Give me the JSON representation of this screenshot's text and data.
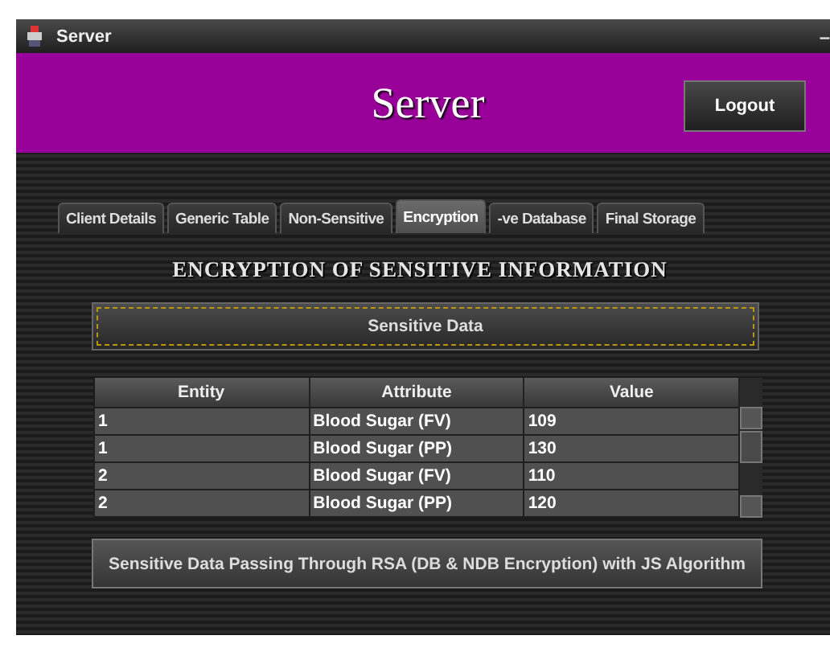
{
  "window": {
    "title": "Server",
    "minimize": "–"
  },
  "header": {
    "title": "Server",
    "logout": "Logout"
  },
  "tabs": [
    {
      "label": "Client Details",
      "selected": false
    },
    {
      "label": "Generic Table",
      "selected": false
    },
    {
      "label": "Non-Sensitive",
      "selected": false
    },
    {
      "label": "Encryption",
      "selected": true
    },
    {
      "label": "-ve Database",
      "selected": false
    },
    {
      "label": "Final Storage",
      "selected": false
    }
  ],
  "heading": "ENCRYPTION OF SENSITIVE INFORMATION",
  "sensitive_button": {
    "label": "Sensitive Data",
    "focused": true
  },
  "table": {
    "columns": [
      "Entity",
      "Attribute",
      "Value"
    ],
    "rows": [
      [
        "1",
        "Blood Sugar (FV)",
        "109"
      ],
      [
        "1",
        "Blood Sugar (PP)",
        "130"
      ],
      [
        "2",
        "Blood Sugar (FV)",
        "110"
      ],
      [
        "2",
        "Blood Sugar (PP)",
        "120"
      ]
    ]
  },
  "action_button": "Sensitive Data Passing Through RSA (DB & NDB Encryption) with JS Algorithm"
}
